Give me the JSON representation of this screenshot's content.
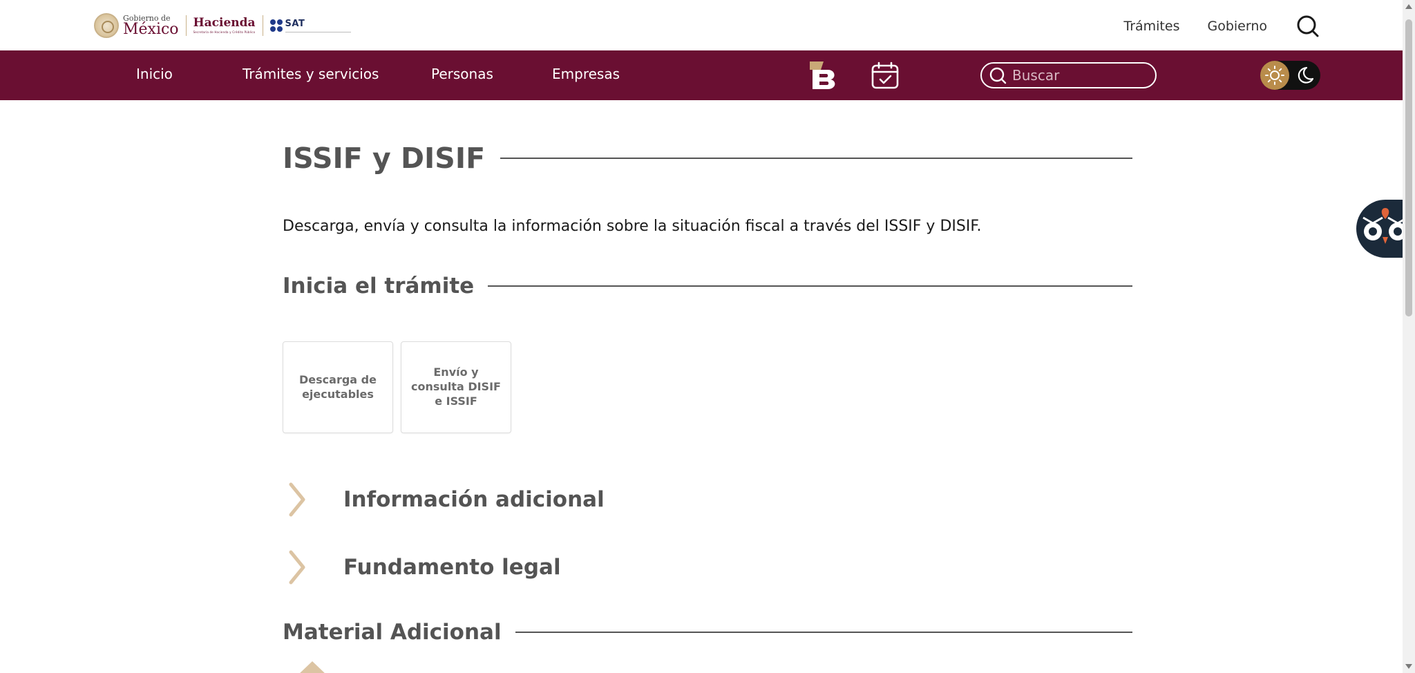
{
  "header": {
    "logo_gob_small": "Gobierno de",
    "logo_gob_big": "México",
    "logo_hacienda": "Hacienda",
    "logo_hacienda_sub": "Secretaría de Hacienda y Crédito Público",
    "logo_sat": "SAT",
    "links": [
      "Trámites",
      "Gobierno"
    ],
    "search_icon": "search-icon"
  },
  "nav": {
    "items": [
      "Inicio",
      "Trámites y servicios",
      "Personas",
      "Empresas"
    ],
    "search_placeholder": "Buscar",
    "icons": [
      "b-logo-icon",
      "calendar-check-icon",
      "search-icon",
      "sun-icon",
      "moon-icon"
    ]
  },
  "main": {
    "title": "ISSIF y DISIF",
    "description": "Descarga, envía y consulta la información sobre la situación fiscal a través del ISSIF y DISIF.",
    "section_start": "Inicia el trámite",
    "cards": [
      {
        "label": "Descarga de ejecutables"
      },
      {
        "label": "Envío y consulta DISIF e ISSIF"
      }
    ],
    "accordions": [
      {
        "label": "Información adicional"
      },
      {
        "label": "Fundamento legal"
      }
    ],
    "section_material": "Material Adicional"
  },
  "colors": {
    "brand_primary": "#6a0f32",
    "accent_gold": "#c9a877",
    "heading_gray": "#545454",
    "owl_bg": "#1b2a3a"
  }
}
